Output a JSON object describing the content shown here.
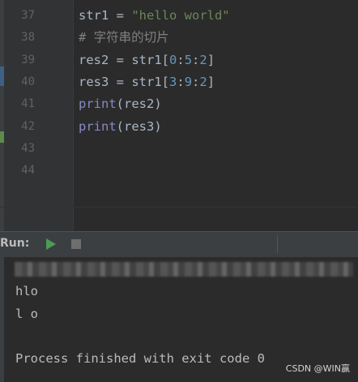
{
  "editor": {
    "lines": [
      {
        "no": "37",
        "tokens": [
          {
            "t": "str1",
            "c": "ident"
          },
          {
            "t": " = ",
            "c": "op"
          },
          {
            "t": "\"hello world\"",
            "c": "str"
          }
        ]
      },
      {
        "no": "38",
        "tokens": [
          {
            "t": "# 字符串的切片",
            "c": "cmt"
          }
        ]
      },
      {
        "no": "39",
        "tokens": [
          {
            "t": "res2",
            "c": "ident"
          },
          {
            "t": " = ",
            "c": "op"
          },
          {
            "t": "str1[",
            "c": "ident"
          },
          {
            "t": "0",
            "c": "num"
          },
          {
            "t": ":",
            "c": "op"
          },
          {
            "t": "5",
            "c": "num"
          },
          {
            "t": ":",
            "c": "op"
          },
          {
            "t": "2",
            "c": "num"
          },
          {
            "t": "]",
            "c": "ident"
          }
        ]
      },
      {
        "no": "40",
        "tokens": [
          {
            "t": "res3",
            "c": "ident"
          },
          {
            "t": " = ",
            "c": "op"
          },
          {
            "t": "str1[",
            "c": "ident"
          },
          {
            "t": "3",
            "c": "num"
          },
          {
            "t": ":",
            "c": "op"
          },
          {
            "t": "9",
            "c": "num"
          },
          {
            "t": ":",
            "c": "op"
          },
          {
            "t": "2",
            "c": "num"
          },
          {
            "t": "]",
            "c": "ident"
          }
        ]
      },
      {
        "no": "41",
        "tokens": [
          {
            "t": "print",
            "c": "builtin"
          },
          {
            "t": "(res2)",
            "c": "ident"
          }
        ]
      },
      {
        "no": "42",
        "tokens": [
          {
            "t": "print",
            "c": "builtin"
          },
          {
            "t": "(res3)",
            "c": "ident"
          }
        ]
      },
      {
        "no": "43",
        "tokens": []
      },
      {
        "no": "44",
        "tokens": []
      }
    ]
  },
  "run_panel": {
    "label": "Run:",
    "output_lines": [
      "hlo",
      "l o",
      "",
      "Process finished with exit code 0"
    ]
  },
  "watermark": "CSDN @WIN赢",
  "colors": {
    "background": "#2b2b2b",
    "gutter": "#313335",
    "panel_header": "#3c3f41",
    "run_green": "#499c54",
    "string": "#6a8759",
    "number": "#6897bb",
    "comment": "#808080",
    "builtin": "#8888c6",
    "text": "#a9b7c6"
  }
}
